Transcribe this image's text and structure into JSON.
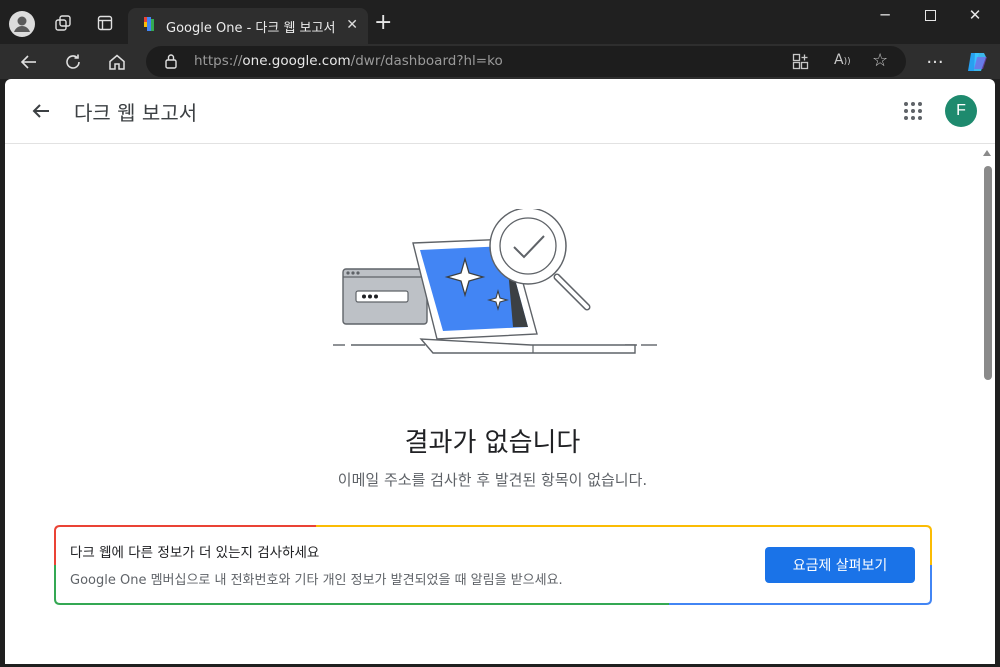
{
  "browser": {
    "tab_title": "Google One - 다크 웹 보고서",
    "url_prefix": "https://",
    "url_host": "one.google.com",
    "url_path": "/dwr/dashboard?hl=ko"
  },
  "app": {
    "title": "다크 웹 보고서",
    "avatar_initial": "F"
  },
  "main": {
    "headline": "결과가 없습니다",
    "subtext": "이메일 주소를 검사한 후 발견된 항목이 없습니다."
  },
  "card": {
    "title": "다크 웹에 다른 정보가 더 있는지 검사하세요",
    "description": "Google One 멤버십으로 내 전화번호와 기타 개인 정보가 발견되었을 때 알림을 받으세요.",
    "button_label": "요금제 살펴보기"
  },
  "colors": {
    "accent_blue": "#1a73e8",
    "google_red": "#ea4335",
    "google_yellow": "#fbbc04",
    "google_green": "#34a853",
    "avatar_green": "#1e8a6e"
  }
}
